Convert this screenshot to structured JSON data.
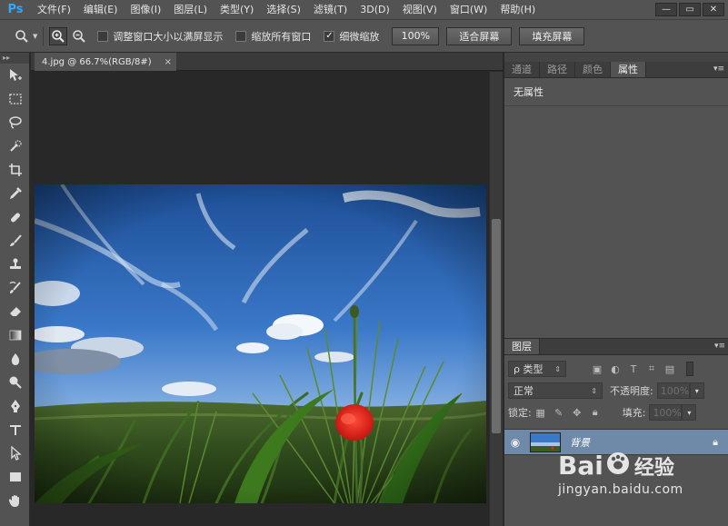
{
  "app": {
    "logo": "Ps",
    "menu": [
      "文件(F)",
      "编辑(E)",
      "图像(I)",
      "图层(L)",
      "类型(Y)",
      "选择(S)",
      "滤镜(T)",
      "3D(D)",
      "视图(V)",
      "窗口(W)",
      "帮助(H)"
    ],
    "window_controls": {
      "minimize": "—",
      "restore": "▭",
      "close": "✕"
    }
  },
  "options": {
    "checkbox_resize": {
      "label": "调整窗口大小以满屏显示",
      "checked": false
    },
    "checkbox_zoom_all": {
      "label": "缩放所有窗口",
      "checked": false
    },
    "checkbox_scrubby": {
      "label": "细微缩放",
      "checked": true
    },
    "zoom_100": "100%",
    "fit_screen": "适合屏幕",
    "fill_screen": "填充屏幕"
  },
  "document": {
    "tab_title": "4.jpg @ 66.7%(RGB/8#)",
    "close": "×"
  },
  "panels": {
    "top_tabs": [
      "通道",
      "路径",
      "颜色",
      "属性"
    ],
    "active_top_tab": "属性",
    "properties_text": "无属性",
    "layers_tab": "图层",
    "filter_kind": "ρ 类型",
    "blend_mode": "正常",
    "opacity_label": "不透明度:",
    "opacity_value": "100%",
    "lock_label": "锁定:",
    "fill_label": "填充:",
    "fill_value": "100%",
    "layer_name": "背景"
  },
  "watermark": {
    "brand_left": "Bai",
    "brand_right": "经验",
    "url": "jingyan.baidu.com"
  }
}
